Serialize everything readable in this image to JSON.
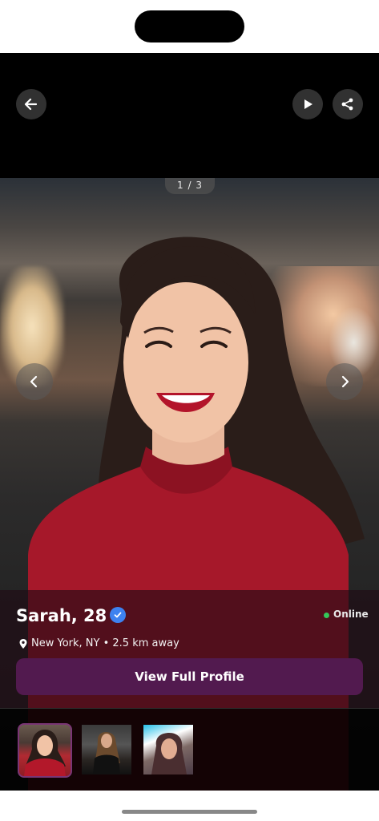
{
  "gallery": {
    "counter": "1 / 3",
    "photo_count": 3,
    "current_index": 1
  },
  "profile": {
    "name_age": "Sarah, 28",
    "status": "Online",
    "location": "New York, NY • 2.5 km away",
    "cta_label": "View Full Profile"
  },
  "icons": {
    "back": "arrow-left-icon",
    "play": "play-icon",
    "share": "share-icon",
    "prev": "chevron-left-icon",
    "next": "chevron-right-icon",
    "verified": "verified-badge-icon",
    "location": "map-pin-icon"
  },
  "colors": {
    "accent": "#521a4f",
    "verified": "#3d82f0",
    "online": "#34c759"
  }
}
